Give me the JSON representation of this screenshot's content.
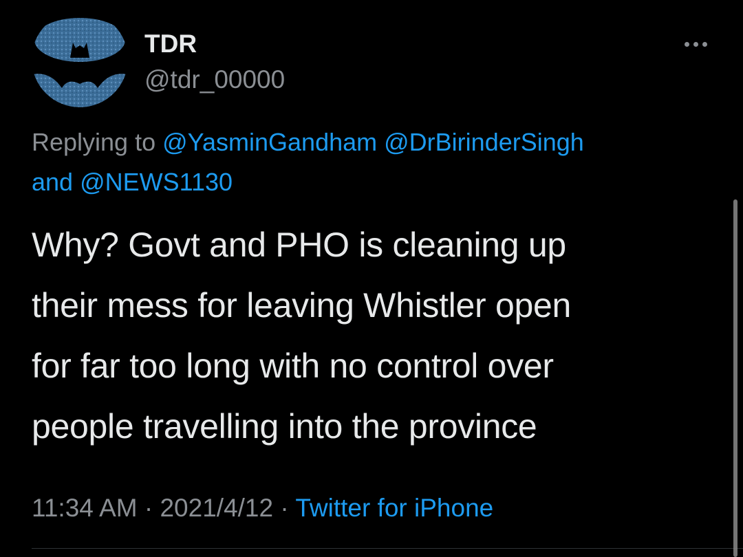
{
  "tweet": {
    "display_name": "TDR",
    "handle": "@tdr_00000",
    "more_icon": "more-horizontal-icon",
    "reply": {
      "prefix": "Replying to ",
      "mentions": [
        "@YasminGandham",
        "@DrBirinderSingh",
        "@NEWS1130"
      ],
      "connector": "and "
    },
    "text_lines": [
      "Why? Govt and PHO is cleaning up",
      "their mess for leaving Whistler open",
      "for far too long with no control over",
      "people travelling into the province"
    ],
    "meta": {
      "time": "11:34 AM",
      "separator": " · ",
      "date": "2021/4/12",
      "source": "Twitter for iPhone"
    }
  },
  "colors": {
    "background": "#000000",
    "primary_text": "#e7e9ea",
    "secondary_text": "#8b8f94",
    "link": "#1d9bf0",
    "avatar_blue": "#3f6f9a"
  }
}
